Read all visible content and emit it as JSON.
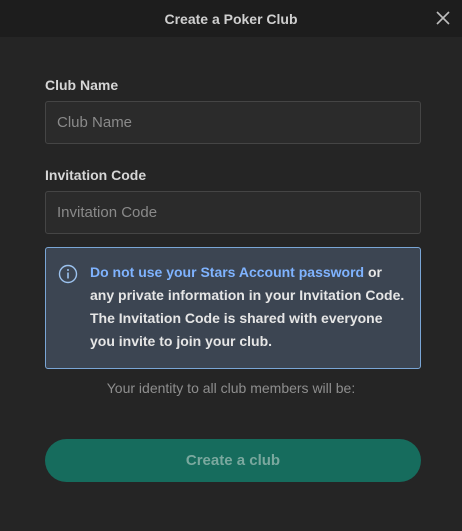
{
  "dialog": {
    "title": "Create a Poker Club",
    "close_icon": "close-icon"
  },
  "form": {
    "club_name": {
      "label": "Club Name",
      "value": "",
      "placeholder": "Club Name"
    },
    "invitation_code": {
      "label": "Invitation Code",
      "value": "",
      "placeholder": "Invitation Code"
    }
  },
  "notice": {
    "icon": "info-icon",
    "highlight": "Do not use your Stars Account password",
    "text": " or any private information in your Invitation Code. The Invitation Code is shared with everyone you invite to join your club."
  },
  "identity_text": "Your identity to all club members will be:",
  "create_button_label": "Create a club",
  "colors": {
    "background": "#252525",
    "titlebar": "#1d1d1d",
    "notice_border": "#7aa6d6",
    "notice_bg": "#3c4552",
    "link": "#7fb3ff",
    "button_bg": "#166c5d",
    "button_text": "#7aa89e"
  }
}
